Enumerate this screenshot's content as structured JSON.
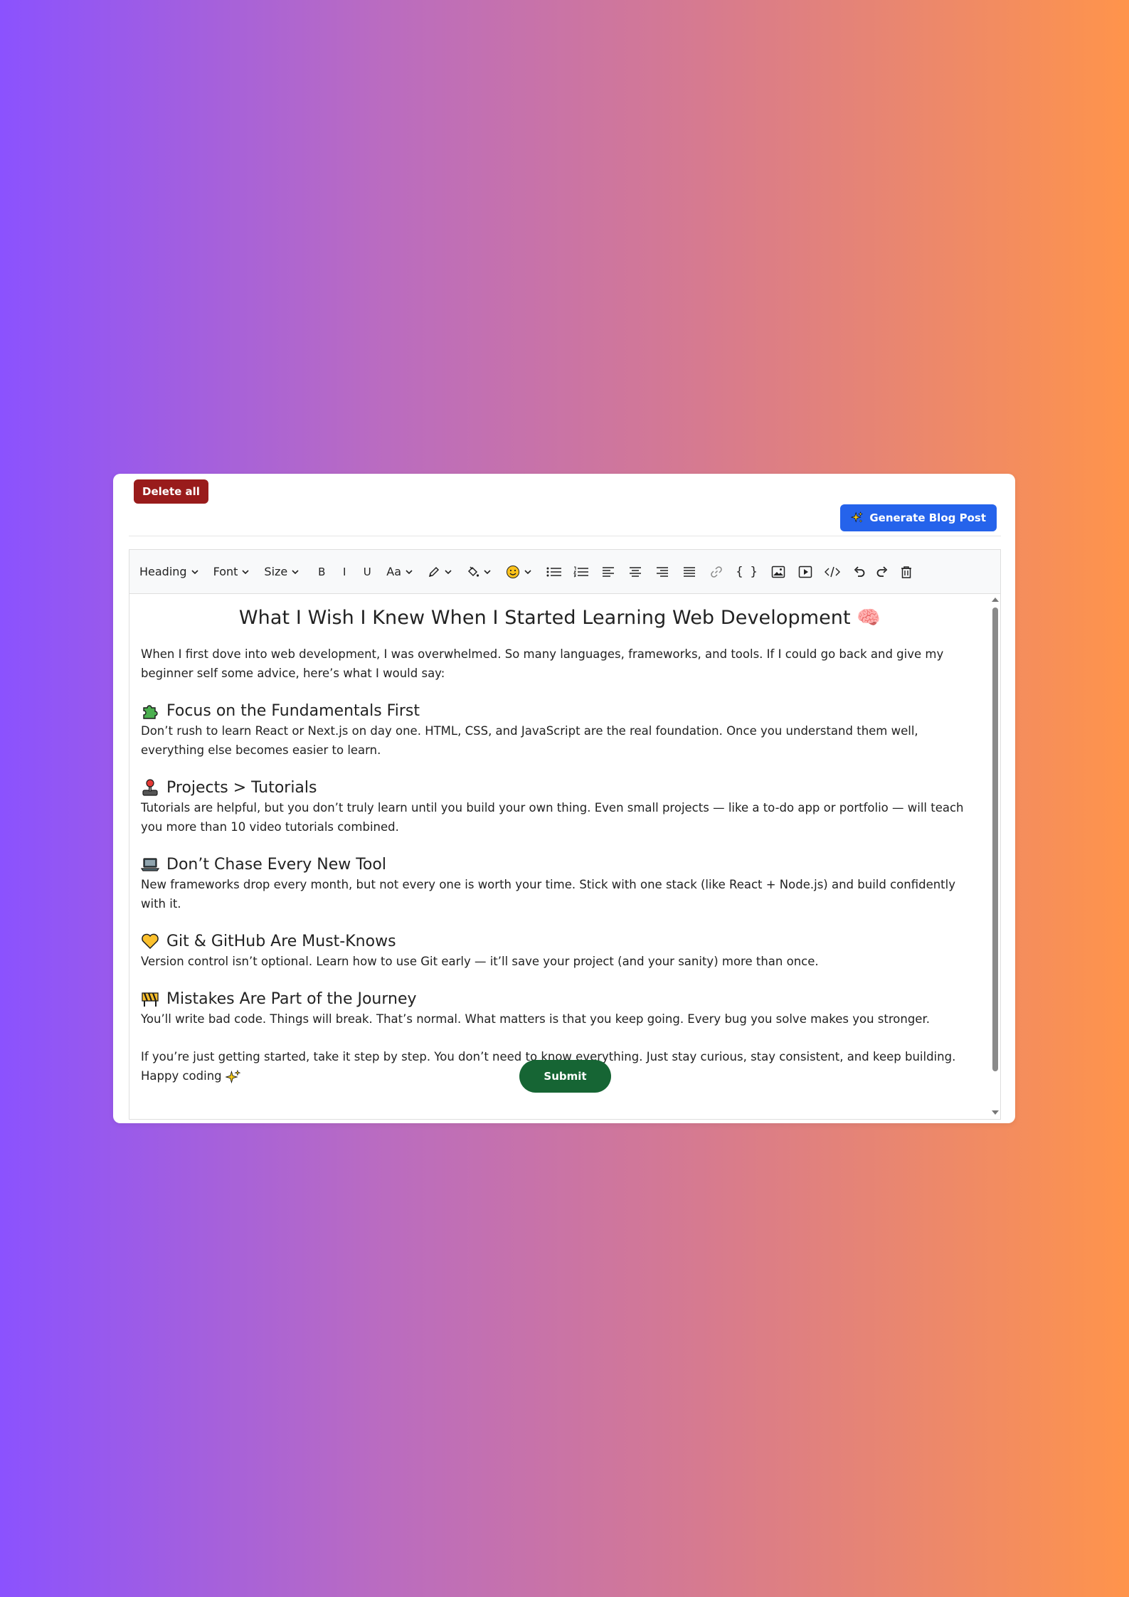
{
  "toolbar_top": {
    "delete_label": "Delete all",
    "generate_label": "Generate Blog Post"
  },
  "editor_toolbar": {
    "heading": "Heading",
    "font": "Font",
    "size": "Size",
    "bold": "B",
    "italic": "I",
    "underline": "U",
    "text_case": "Aa",
    "code_block": "{ }"
  },
  "post": {
    "title": "What I Wish I Knew When I Started Learning Web Development 🧠",
    "intro": "When I first dove into web development, I was overwhelmed. So many languages, frameworks, and tools. If I could go back and give my beginner self some advice, here’s what I would say:",
    "sections": [
      {
        "icon": "puzzle-icon",
        "heading": "Focus on the Fundamentals First",
        "body": "Don’t rush to learn React or Next.js on day one. HTML, CSS, and JavaScript are the real foundation. Once you understand them well, everything else becomes easier to learn."
      },
      {
        "icon": "joystick-icon",
        "heading": "Projects > Tutorials",
        "body": "Tutorials are helpful, but you don’t truly learn until you build your own thing. Even small projects — like a to-do app or portfolio — will teach you more than 10 video tutorials combined."
      },
      {
        "icon": "laptop-icon",
        "heading": "Don’t Chase Every New Tool",
        "body": "New frameworks drop every month, but not every one is worth your time. Stick with one stack (like React + Node.js) and build confidently with it."
      },
      {
        "icon": "yellow-heart-icon",
        "heading": "Git & GitHub Are Must-Knows",
        "body": "Version control isn’t optional. Learn how to use Git early — it’ll save your project (and your sanity) more than once."
      },
      {
        "icon": "construction-icon",
        "heading": "Mistakes Are Part of the Journey",
        "body": "You’ll write bad code. Things will break. That’s normal. What matters is that you keep going. Every bug you solve makes you stronger."
      }
    ],
    "closing": "If you’re just getting started, take it step by step. You don’t need to know everything. Just stay curious, stay consistent, and keep building. Happy coding"
  },
  "submit_label": "Submit",
  "colors": {
    "delete": "#991b1b",
    "generate": "#2563eb",
    "submit": "#166534",
    "bg_start": "#8b52fe",
    "bg_end": "#ff944b"
  }
}
